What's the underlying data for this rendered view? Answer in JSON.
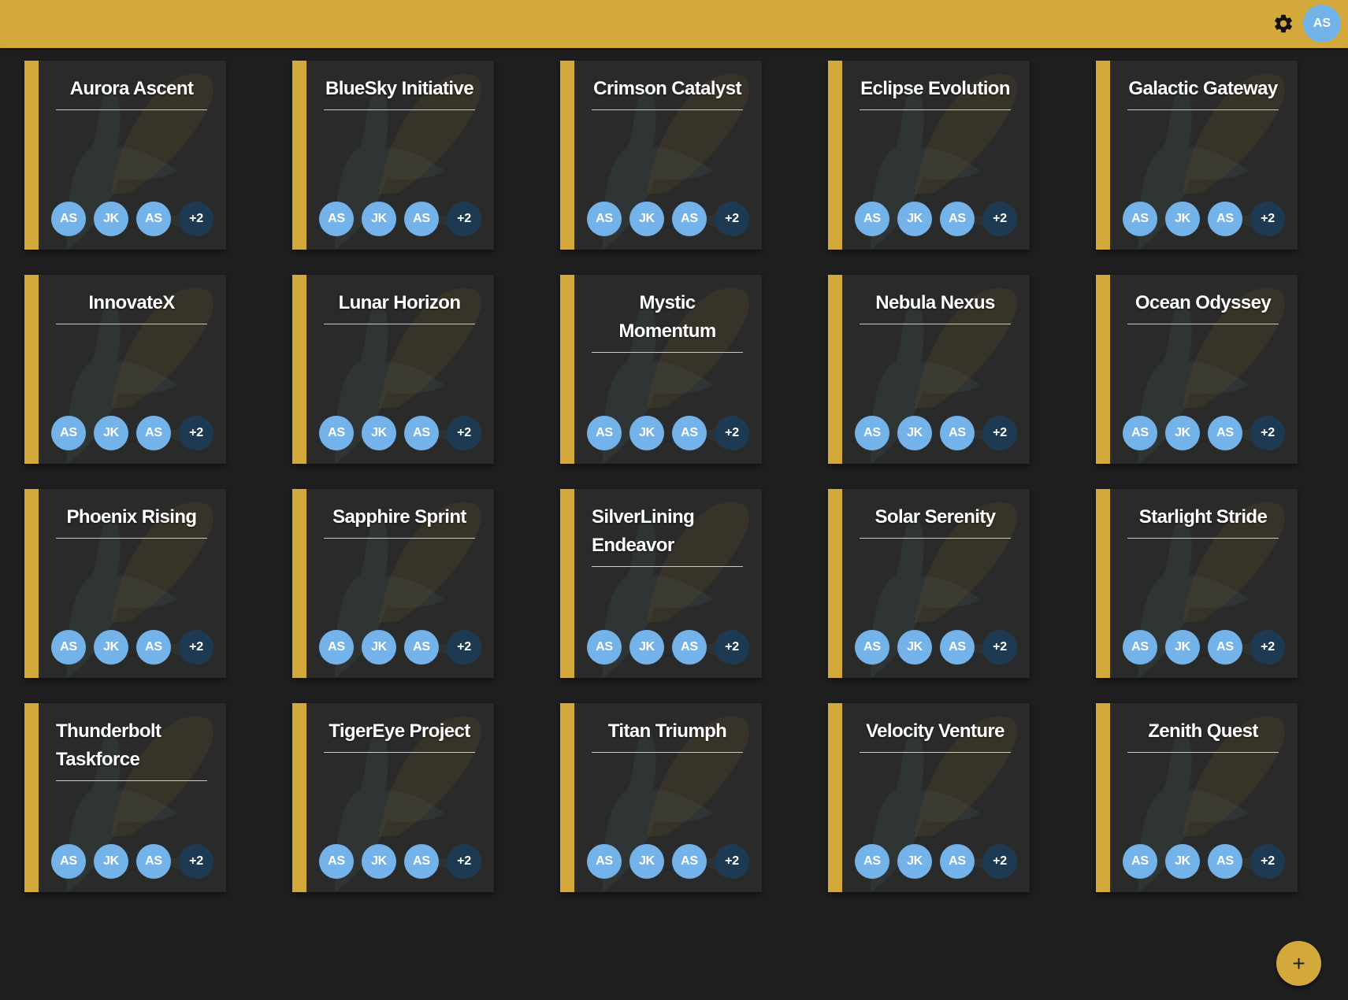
{
  "colors": {
    "accent": "#d2a93a",
    "background": "#1f1f1f",
    "card": "#2a2a2a",
    "avatar": "#74b2ea",
    "avatar_more": "#1d3a52"
  },
  "header": {
    "settings_icon": "gear-icon",
    "user_initials": "AS"
  },
  "projects": [
    {
      "title": "Aurora Ascent",
      "members": [
        "AS",
        "JK",
        "AS"
      ],
      "more": "+2"
    },
    {
      "title": "BlueSky Initiative",
      "members": [
        "AS",
        "JK",
        "AS"
      ],
      "more": "+2"
    },
    {
      "title": "Crimson Catalyst",
      "members": [
        "AS",
        "JK",
        "AS"
      ],
      "more": "+2"
    },
    {
      "title": "Eclipse Evolution",
      "members": [
        "AS",
        "JK",
        "AS"
      ],
      "more": "+2"
    },
    {
      "title": "Galactic Gateway",
      "members": [
        "AS",
        "JK",
        "AS"
      ],
      "more": "+2"
    },
    {
      "title": "InnovateX",
      "members": [
        "AS",
        "JK",
        "AS"
      ],
      "more": "+2"
    },
    {
      "title": "Lunar Horizon",
      "members": [
        "AS",
        "JK",
        "AS"
      ],
      "more": "+2"
    },
    {
      "title": "Mystic Momentum",
      "members": [
        "AS",
        "JK",
        "AS"
      ],
      "more": "+2"
    },
    {
      "title": "Nebula Nexus",
      "members": [
        "AS",
        "JK",
        "AS"
      ],
      "more": "+2"
    },
    {
      "title": "Ocean Odyssey",
      "members": [
        "AS",
        "JK",
        "AS"
      ],
      "more": "+2"
    },
    {
      "title": "Phoenix Rising",
      "members": [
        "AS",
        "JK",
        "AS"
      ],
      "more": "+2"
    },
    {
      "title": "Sapphire Sprint",
      "members": [
        "AS",
        "JK",
        "AS"
      ],
      "more": "+2"
    },
    {
      "title": "SilverLining Endeavor",
      "members": [
        "AS",
        "JK",
        "AS"
      ],
      "more": "+2"
    },
    {
      "title": "Solar Serenity",
      "members": [
        "AS",
        "JK",
        "AS"
      ],
      "more": "+2"
    },
    {
      "title": "Starlight Stride",
      "members": [
        "AS",
        "JK",
        "AS"
      ],
      "more": "+2"
    },
    {
      "title": "Thunderbolt Taskforce",
      "members": [
        "AS",
        "JK",
        "AS"
      ],
      "more": "+2"
    },
    {
      "title": "TigerEye Project",
      "members": [
        "AS",
        "JK",
        "AS"
      ],
      "more": "+2"
    },
    {
      "title": "Titan Triumph",
      "members": [
        "AS",
        "JK",
        "AS"
      ],
      "more": "+2"
    },
    {
      "title": "Velocity Venture",
      "members": [
        "AS",
        "JK",
        "AS"
      ],
      "more": "+2"
    },
    {
      "title": "Zenith Quest",
      "members": [
        "AS",
        "JK",
        "AS"
      ],
      "more": "+2"
    }
  ],
  "fab": {
    "icon": "plus-icon",
    "label": "+"
  }
}
